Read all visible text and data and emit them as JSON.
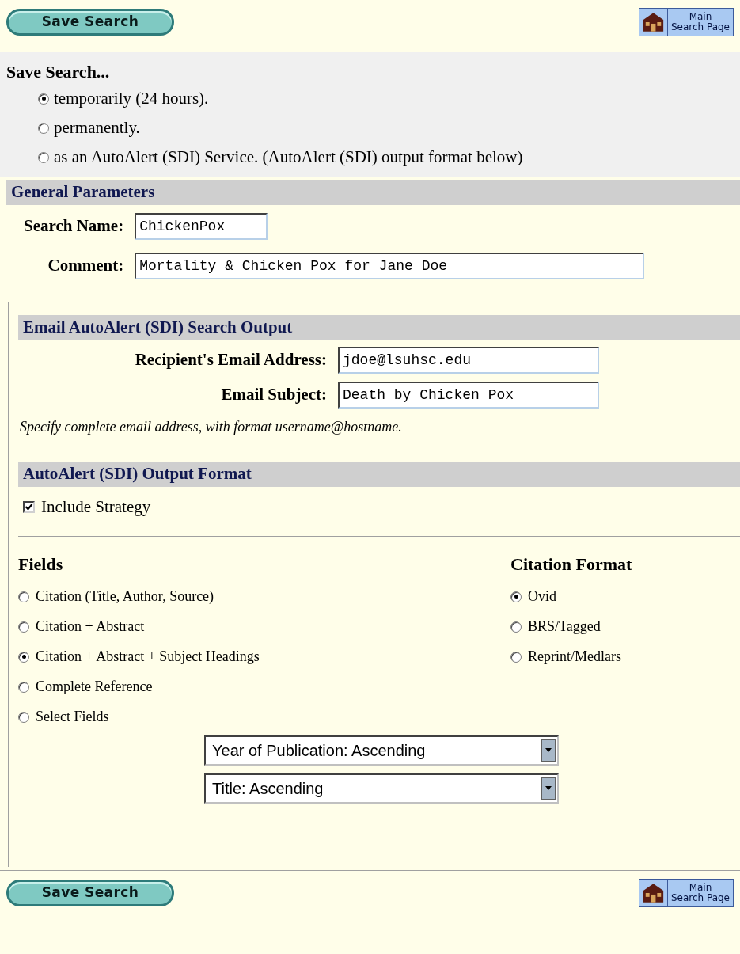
{
  "top_bar": {
    "save_button": "Save Search",
    "main_link": [
      "Main",
      "Search Page"
    ]
  },
  "save_search": {
    "title": "Save Search...",
    "options": [
      {
        "label": "temporarily (24 hours).",
        "selected": true
      },
      {
        "label": "permanently.",
        "selected": false
      },
      {
        "label": "as an AutoAlert (SDI) Service. (AutoAlert (SDI) output format below)",
        "selected": false
      }
    ]
  },
  "general_parameters": {
    "title": "General Parameters",
    "fields": [
      {
        "label": "Search Name:",
        "value": "ChickenPox"
      },
      {
        "label": "Comment:",
        "value": "Mortality & Chicken Pox for Jane Doe"
      }
    ]
  },
  "email_output": {
    "title": "Email AutoAlert (SDI) Search Output",
    "fields": [
      {
        "label": "Recipient's Email Address:",
        "value": "jdoe@lsuhsc.edu"
      },
      {
        "label": "Email Subject:",
        "value": "Death by Chicken Pox"
      }
    ],
    "note": "Specify complete email address, with format username@hostname."
  },
  "output_format": {
    "title": "AutoAlert (SDI) Output Format",
    "include_strategy": {
      "label": "Include Strategy",
      "checked": true
    },
    "fields": {
      "title": "Fields",
      "options": [
        {
          "label": "Citation (Title, Author, Source)",
          "selected": false
        },
        {
          "label": "Citation + Abstract",
          "selected": false
        },
        {
          "label": "Citation + Abstract + Subject Headings",
          "selected": true
        },
        {
          "label": "Complete Reference",
          "selected": false
        },
        {
          "label": "Select Fields",
          "selected": false
        }
      ]
    },
    "citation_format": {
      "title": "Citation Format",
      "options": [
        {
          "label": "Ovid",
          "selected": true
        },
        {
          "label": "BRS/Tagged",
          "selected": false
        },
        {
          "label": "Reprint/Medlars",
          "selected": false
        }
      ]
    },
    "sort": [
      "Year of Publication: Ascending",
      "Title: Ascending"
    ]
  },
  "bottom_bar": {
    "save_button": "Save Search",
    "main_link": [
      "Main",
      "Search Page"
    ]
  }
}
